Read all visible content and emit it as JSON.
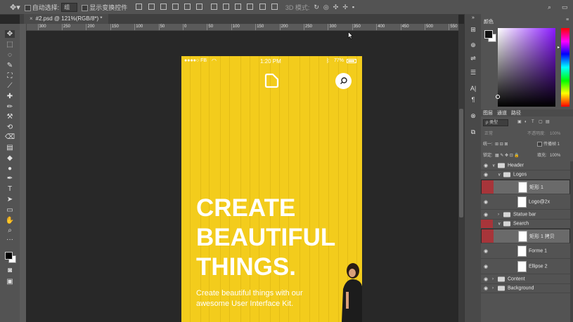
{
  "options_bar": {
    "auto_select_label": "自动选择:",
    "auto_select_value": "组",
    "show_transform_label": "显示变换控件",
    "mode_3d_label": "3D 模式:"
  },
  "document": {
    "tab_title": "#2.psd @ 121%(RGB/8*) *"
  },
  "ruler": {
    "h_labels": [
      "600",
      "550",
      "500",
      "450",
      "400",
      "350",
      "300",
      "250",
      "200",
      "150",
      "100",
      "50",
      "0",
      "50",
      "100",
      "150",
      "200",
      "250",
      "300",
      "350",
      "400",
      "450",
      "500",
      "550",
      "600",
      "650",
      "700",
      "750",
      "800",
      "850",
      "900",
      "950",
      "1000",
      "1050",
      "1100",
      "1150"
    ]
  },
  "mockup": {
    "status_carrier": "●●●●○ FB",
    "status_time": "1:20 PM",
    "status_battery": "77%",
    "headline_lines": [
      "CREATE",
      "BEAUTIFUL",
      "THINGS."
    ],
    "subtext_line1": "Create beautiful things with our",
    "subtext_line2": "awesome User Interface Kit.",
    "bg_color": "#f3cc1c"
  },
  "color_panel": {
    "tab_label": "颜色"
  },
  "layers_panel": {
    "tabs": [
      "图层",
      "通道",
      "路径"
    ],
    "filter_label": "ρ 类型",
    "blend_mode": "正常",
    "opacity_label": "不透明度:",
    "opacity_value": "100%",
    "lock_label": "锁定:",
    "fill_label": "填充:",
    "fill_value": "100%",
    "consolidate_label": "统一:",
    "propagate_label": "传播帧 1"
  },
  "layers": [
    {
      "name": "Header",
      "kind": "group",
      "depth": 0,
      "expanded": true,
      "selected": false,
      "red": false
    },
    {
      "name": "Logos",
      "kind": "group",
      "depth": 1,
      "expanded": true,
      "selected": false,
      "red": false
    },
    {
      "name": "矩形 1",
      "kind": "layer",
      "depth": 2,
      "selected": true,
      "red": true
    },
    {
      "name": "Logo@2x",
      "kind": "layer",
      "depth": 2,
      "selected": false,
      "red": false
    },
    {
      "name": "Statue bar",
      "kind": "group",
      "depth": 1,
      "expanded": false,
      "selected": false,
      "red": false
    },
    {
      "name": "Search",
      "kind": "group",
      "depth": 1,
      "expanded": true,
      "selected": false,
      "red": true
    },
    {
      "name": "矩形 1 拷贝",
      "kind": "layer",
      "depth": 2,
      "selected": true,
      "red": true
    },
    {
      "name": "Forme 1",
      "kind": "layer",
      "depth": 2,
      "selected": false,
      "red": false
    },
    {
      "name": "Ellipse 2",
      "kind": "layer",
      "depth": 2,
      "selected": false,
      "red": false
    },
    {
      "name": "Content",
      "kind": "group",
      "depth": 0,
      "expanded": false,
      "selected": false,
      "red": false
    },
    {
      "name": "Background",
      "kind": "group",
      "depth": 0,
      "expanded": false,
      "selected": false,
      "red": false
    }
  ],
  "tools": [
    "move-tool-icon",
    "marquee-tool-icon",
    "lasso-tool-icon",
    "quick-select-tool-icon",
    "crop-tool-icon",
    "eyedropper-tool-icon",
    "healing-brush-icon",
    "brush-tool-icon",
    "clone-stamp-icon",
    "history-brush-icon",
    "eraser-tool-icon",
    "gradient-tool-icon",
    "blur-tool-icon",
    "dodge-tool-icon",
    "pen-tool-icon",
    "type-tool-icon",
    "path-select-icon",
    "rectangle-tool-icon",
    "hand-tool-icon",
    "zoom-tool-icon"
  ]
}
